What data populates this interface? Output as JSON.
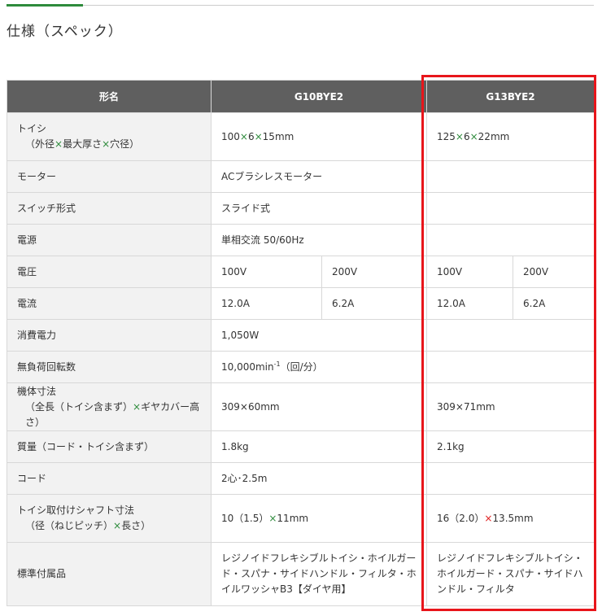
{
  "page": {
    "title": "仕様（スペック）"
  },
  "colors": {
    "accent_green": "#2e8b3c",
    "header_bg": "#5f5f5f",
    "label_bg": "#f2f2f2",
    "highlight_red": "#e8151b"
  },
  "table": {
    "headers": {
      "label": "形名",
      "model_a": "G10BYE2",
      "model_b": "G13BYE2"
    },
    "rows": {
      "wheel": {
        "label_line1": "トイシ",
        "label_line2_a": "（外径",
        "label_line2_x1": "×",
        "label_line2_b": "最大厚さ",
        "label_line2_x2": "×",
        "label_line2_c": "穴径）",
        "a_1": "100",
        "a_x1": "×",
        "a_2": "6",
        "a_x2": "×",
        "a_3": "15mm",
        "b_1": "125",
        "b_x1": "×",
        "b_2": "6",
        "b_x2": "×",
        "b_3": "22mm"
      },
      "motor": {
        "label": "モーター",
        "a": "ACブラシレスモーター",
        "b": ""
      },
      "switch": {
        "label": "スイッチ形式",
        "a": "スライド式",
        "b": ""
      },
      "power_source": {
        "label": "電源",
        "a": "単相交流 50/60Hz",
        "b": ""
      },
      "voltage": {
        "label": "電圧",
        "a1": "100V",
        "a2": "200V",
        "b1": "100V",
        "b2": "200V"
      },
      "current": {
        "label": "電流",
        "a1": "12.0A",
        "a2": "6.2A",
        "b1": "12.0A",
        "b2": "6.2A"
      },
      "power_consumption": {
        "label": "消費電力",
        "a": "1,050W",
        "b": ""
      },
      "no_load_speed": {
        "label": "無負荷回転数",
        "a_main": "10,000min",
        "a_sup": "-1",
        "a_unit": "（回/分）",
        "b": ""
      },
      "dimensions": {
        "label_line1": "機体寸法",
        "label_line2_a": "（全長（トイシ含まず）",
        "label_line2_x": "×",
        "label_line2_b": "ギヤカバー高さ）",
        "a_1": "309",
        "a_x": "×",
        "a_2": "60mm",
        "b_1": "309",
        "b_x": "×",
        "b_2": "71mm"
      },
      "mass": {
        "label": "質量（コード・トイシ含まず）",
        "a": "1.8kg",
        "b": "2.1kg"
      },
      "cord": {
        "label": "コード",
        "a": "2心･2.5m",
        "b": ""
      },
      "shaft": {
        "label_line1": "トイシ取付けシャフト寸法",
        "label_line2_a": "（径（ねじピッチ）",
        "label_line2_x": "×",
        "label_line2_b": "長さ）",
        "a_1": "10（1.5）",
        "a_x": "×",
        "a_2": "11mm",
        "b_1": "16（2.0）",
        "b_x": "×",
        "b_2": "13.5mm"
      },
      "accessories": {
        "label": "標準付属品",
        "a": "レジノイドフレキシブルトイシ・ホイルガード・スパナ・サイドハンドル・フィルタ・ホイルワッシャB3【ダイヤ用】",
        "b": "レジノイドフレキシブルトイシ・ホイルガード・スパナ・サイドハンドル・フィルタ"
      }
    }
  }
}
